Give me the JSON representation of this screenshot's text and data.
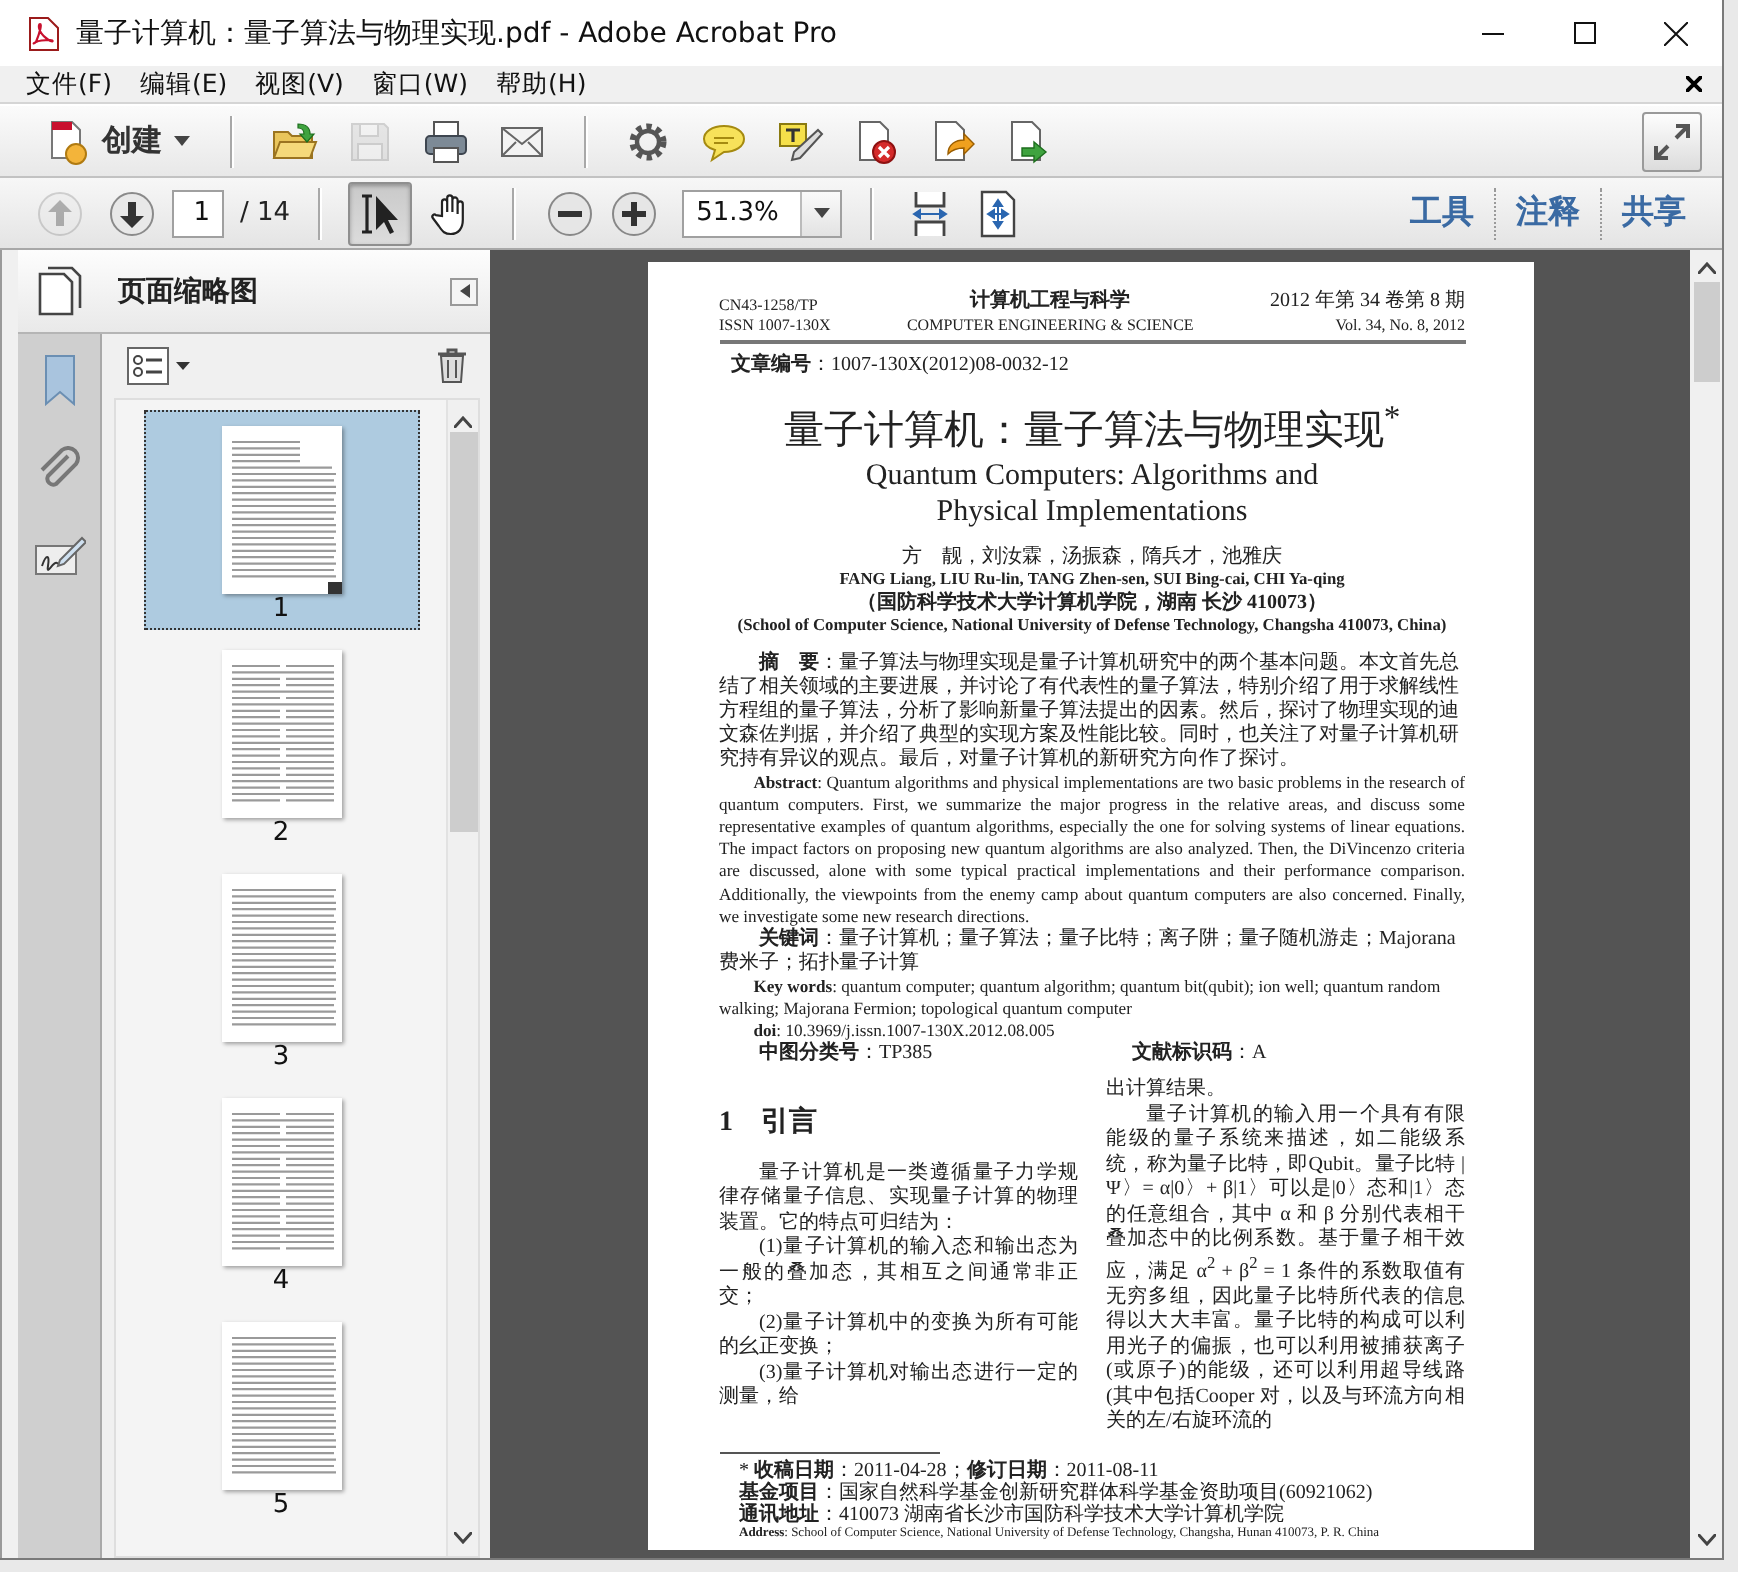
{
  "window": {
    "title": "量子计算机：量子算法与物理实现.pdf - Adobe Acrobat Pro"
  },
  "menu": [
    {
      "label": "文件(F)"
    },
    {
      "label": "编辑(E)"
    },
    {
      "label": "视图(V)"
    },
    {
      "label": "窗口(W)"
    },
    {
      "label": "帮助(H)"
    }
  ],
  "toolbar": {
    "create_label": "创建",
    "button_groups": [
      [
        {
          "kind": "open",
          "disabled": false
        },
        {
          "kind": "save",
          "disabled": true
        },
        {
          "kind": "print",
          "disabled": false
        },
        {
          "kind": "email",
          "disabled": false
        }
      ],
      [
        {
          "kind": "settings",
          "disabled": false
        },
        {
          "kind": "comment",
          "disabled": false
        },
        {
          "kind": "highlight",
          "disabled": false
        },
        {
          "kind": "delete",
          "disabled": false
        },
        {
          "kind": "edit",
          "disabled": false
        },
        {
          "kind": "export",
          "disabled": false
        }
      ]
    ]
  },
  "navigation": {
    "page_buttons": [
      {
        "kind": "previous",
        "disabled": true
      },
      {
        "kind": "next",
        "disabled": false
      }
    ],
    "page": "1",
    "page_count": "/ 14",
    "tools": [
      {
        "kind": "select",
        "selected": true
      },
      {
        "kind": "hand",
        "selected": false
      }
    ],
    "zoom": "51.3%",
    "panes": [
      {
        "label": "工具"
      },
      {
        "label": "注释"
      },
      {
        "label": "共享"
      }
    ]
  },
  "sidebar": {
    "title": "页面缩略图",
    "thumbnails": [
      {
        "label": "1",
        "selected": true
      },
      {
        "label": "2",
        "selected": false
      },
      {
        "label": "3",
        "selected": false
      },
      {
        "label": "4",
        "selected": false
      },
      {
        "label": "5",
        "selected": false
      }
    ]
  },
  "document_page": {
    "header": {
      "left": [
        "CN43-1258/TP",
        "ISSN 1007-130X"
      ],
      "center": [
        "计算机工程与科学",
        "COMPUTER ENGINEERING & SCIENCE"
      ],
      "right": [
        "2012 年第 34 卷第 8 期",
        "Vol. 34, No. 8, 2012"
      ]
    },
    "article_number": "**文章编号**：1007-130X(2012)08-0032-12",
    "title_cn": "量子计算机：量子算法与物理实现$^{*}$",
    "title_en": "Quantum Computers: Algorithms and Physical Implementations",
    "authors_cn": "方　靓，刘汝霖，汤振森，隋兵才，池雅庆",
    "authors_en": "FANG Liang, LIU Ru-lin, TANG Zhen-sen, SUI Bing-cai, CHI Ya-qing",
    "affiliation_cn": "（国防科学技术大学计算机学院，湖南 长沙 410073）",
    "affiliation_en": "(School of Computer Science, National University of Defense Technology, Changsha 410073, China)",
    "abstract_cn": "**摘　要**：量子算法与物理实现是量子计算机研究中的两个基本问题。本文首先总结了相关领域的主要进展，并讨论了有代表性的量子算法，特别介绍了用于求解线性方程组的量子算法，分析了影响新量子算法提出的因素。然后，探讨了物理实现的迪文森佐判据，并介绍了典型的实现方案及性能比较。同时，也关注了对量子计算机研究持有异议的观点。最后，对量子计算机的新研究方向作了探讨。",
    "abstract_en": "**Abstract**: Quantum algorithms and physical implementations are two basic problems in the research of quantum computers. First, we summarize the major progress in the relative areas, and discuss some representative examples of quantum algorithms, especially the one for solving systems of linear equations. The impact factors on proposing new quantum algorithms are also analyzed. Then, the DiVincenzo criteria are discussed, alone with some typical practical implementations and their performance comparison. Additionally, the viewpoints from the enemy camp about quantum computers are also concerned. Finally, we investigate some new research directions.",
    "keywords_cn": "**关键词**：量子计算机；量子算法；量子比特；离子阱；量子随机游走；Majorana 费米子；拓扑量子计算",
    "keywords_en": "**Key words**: quantum computer; quantum algorithm; quantum bit(qubit); ion well; quantum random walking; Majorana Fermion; topological quantum computer",
    "doi": "**doi**: 10.3969/j.issn.1007-130X.2012.08.005",
    "classification": "**中图分类号**：TP385",
    "document_code": "**文献标识码**：A",
    "section_heading": "1　引言",
    "left_column": [
      {
        "kind": "paragraph",
        "text": "量子计算机是一类遵循量子力学规律存储量子信息、实现量子计算的物理装置。它的特点可归结为："
      },
      {
        "kind": "paragraph",
        "text": "(1)量子计算机的输入态和输出态为一般的叠加态，其相互之间通常非正交；"
      },
      {
        "kind": "paragraph",
        "text": "(2)量子计算机中的变换为所有可能的幺正变换；"
      },
      {
        "kind": "paragraph",
        "text": "(3)量子计算机对输出态进行一定的测量，给"
      }
    ],
    "right_column": [
      {
        "kind": "continuation",
        "text": "出计算结果。"
      },
      {
        "kind": "paragraph",
        "text": "量子计算机的输入用一个具有有限能级的量子系统来描述，如二能级系统，称为量子比特，即Qubit。量子比特 |Ψ〉= α|0〉+ β|1〉可以是|0〉态和|1〉态的任意组合，其中 α 和 β 分别代表相干叠加态中的比例系数。基于量子相干效应，满足 α$^{2}$ + β$^{2}$ = 1 条件的系数取值有无穷多组，因此量子比特所代表的信息得以大大丰富。量子比特的构成可以利用光子的偏振，也可以利用被捕获离子(或原子)的能级，还可以利用超导线路(其中包括Cooper 对，以及与环流方向相关的左/右旋环流的"
      }
    ],
    "footnotes": [
      {
        "kind": "cn",
        "text": "* **收稿日期**：2011-04-28；**修订日期**：2011-08-11"
      },
      {
        "kind": "cn",
        "text": "**基金项目**：国家自然科学基金创新研究群体科学基金资助项目(60921062)"
      },
      {
        "kind": "cn",
        "text": "**通讯地址**：410073 湖南省长沙市国防科学技术大学计算机学院"
      },
      {
        "kind": "en",
        "text": "**Address**: School of Computer Science, National University of Defense Technology, Changsha, Hunan 410073, P. R. China"
      }
    ]
  }
}
